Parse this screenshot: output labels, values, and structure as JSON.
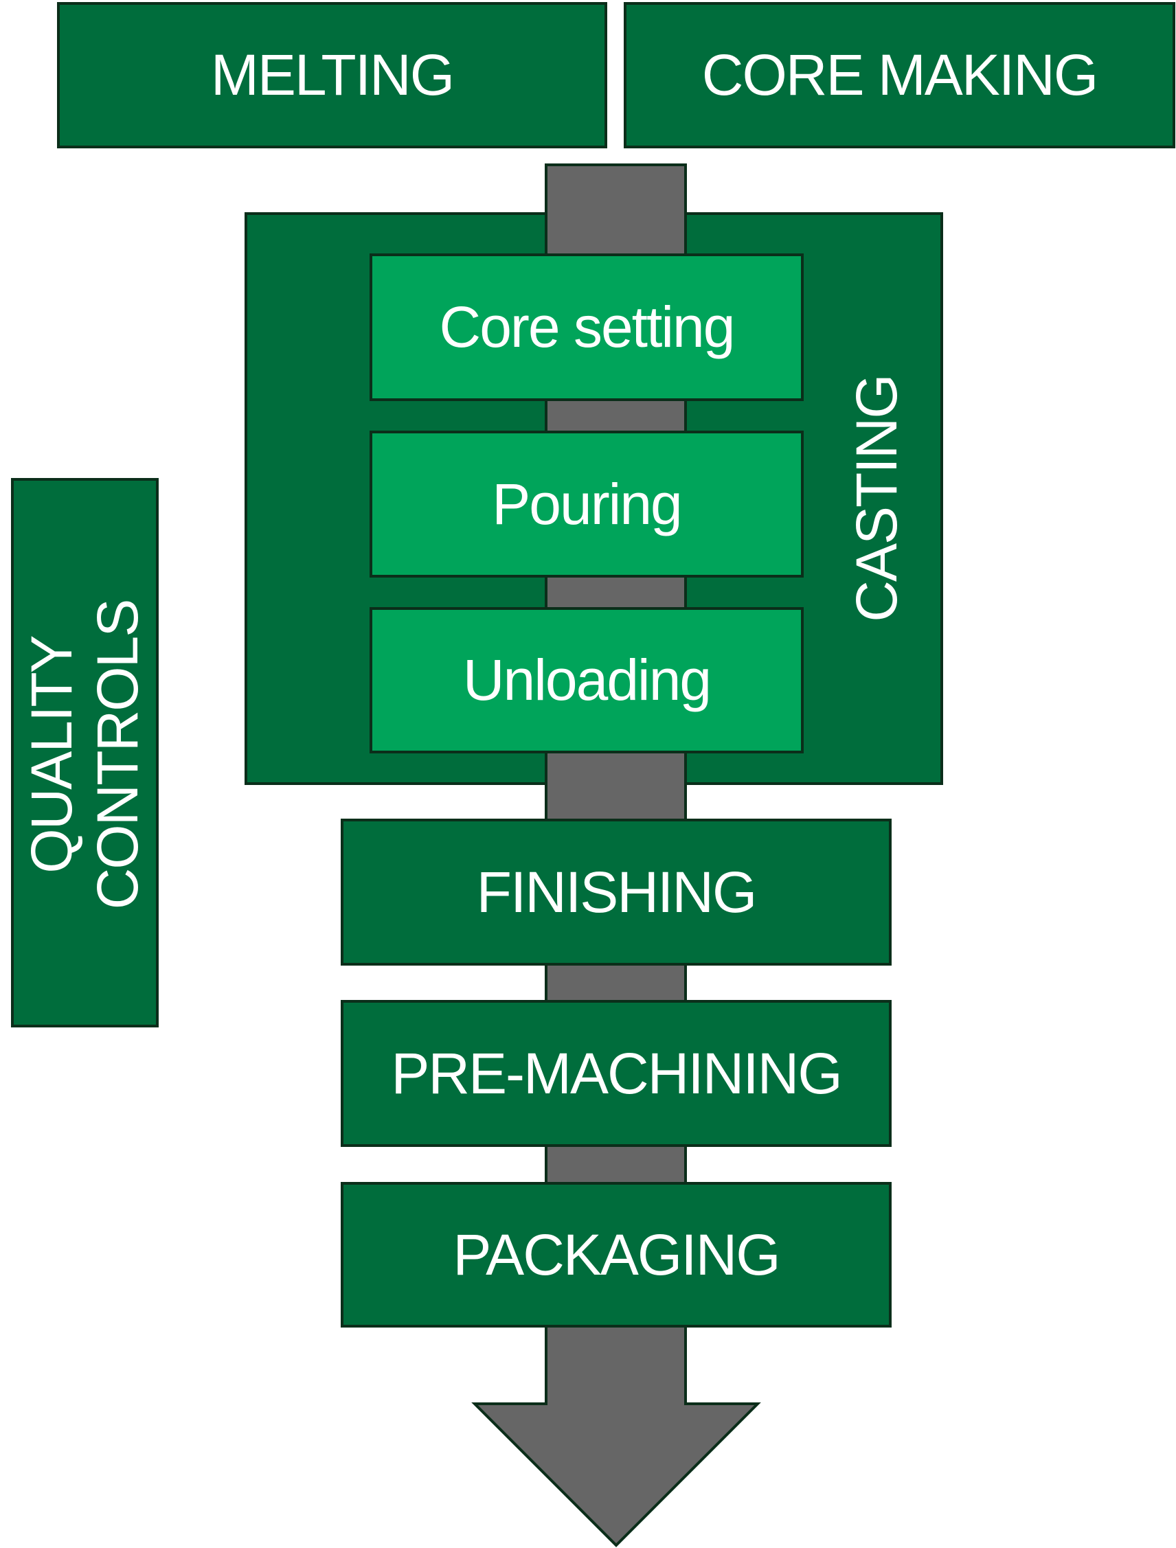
{
  "inputs": [
    "MELTING",
    "CORE MAKING"
  ],
  "casting": {
    "label": "CASTING",
    "steps": [
      "Core setting",
      "Pouring",
      "Unloading"
    ]
  },
  "downstream": [
    "FINISHING",
    "PRE-MACHINING",
    "PACKAGING"
  ],
  "quality_controls": {
    "line1": "QUALITY",
    "line2": "CONTROLS"
  },
  "colors": {
    "dark_green": "#006d3c",
    "light_green": "#00a45a",
    "arrow_gray": "#666666",
    "border": "#0b2e1a"
  }
}
